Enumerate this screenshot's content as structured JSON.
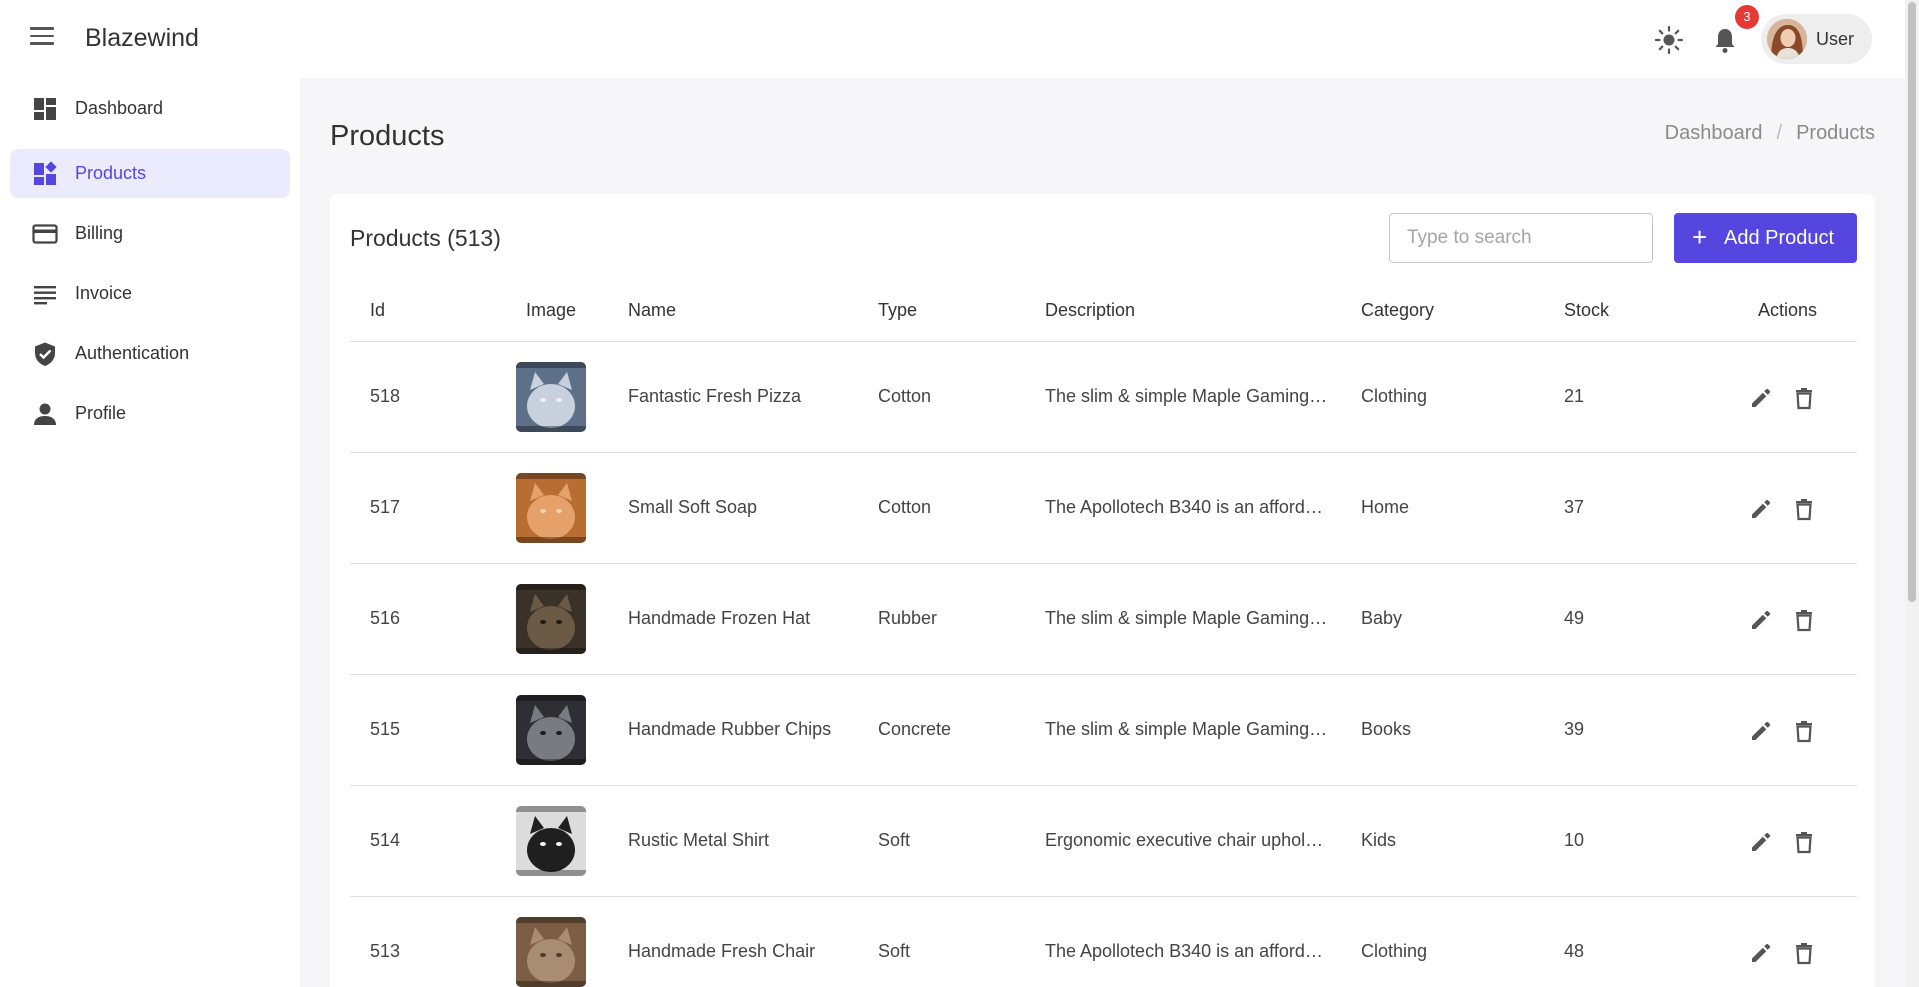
{
  "app": {
    "brand": "Blazewind",
    "notifications_count": "3",
    "user_label": "User"
  },
  "sidebar": {
    "items": [
      {
        "label": "Dashboard",
        "icon": "dashboard-icon"
      },
      {
        "label": "Products",
        "icon": "products-icon",
        "active": true
      },
      {
        "label": "Billing",
        "icon": "credit-card-icon"
      },
      {
        "label": "Invoice",
        "icon": "lines-icon"
      },
      {
        "label": "Authentication",
        "icon": "shield-icon"
      },
      {
        "label": "Profile",
        "icon": "person-icon"
      }
    ]
  },
  "page": {
    "title": "Products",
    "breadcrumb": [
      "Dashboard",
      "Products"
    ]
  },
  "card": {
    "title": "Products (513)",
    "search_placeholder": "Type to search",
    "add_button": "Add Product"
  },
  "table": {
    "headers": [
      "Id",
      "Image",
      "Name",
      "Type",
      "Description",
      "Category",
      "Stock",
      "Actions"
    ],
    "rows": [
      {
        "id": "518",
        "name": "Fantastic Fresh Pizza",
        "type": "Cotton",
        "description": "The slim & simple Maple Gaming…",
        "category": "Clothing",
        "stock": "21"
      },
      {
        "id": "517",
        "name": "Small Soft Soap",
        "type": "Cotton",
        "description": "The Apollotech B340 is an afford…",
        "category": "Home",
        "stock": "37"
      },
      {
        "id": "516",
        "name": "Handmade Frozen Hat",
        "type": "Rubber",
        "description": "The slim & simple Maple Gaming…",
        "category": "Baby",
        "stock": "49"
      },
      {
        "id": "515",
        "name": "Handmade Rubber Chips",
        "type": "Concrete",
        "description": "The slim & simple Maple Gaming…",
        "category": "Books",
        "stock": "39"
      },
      {
        "id": "514",
        "name": "Rustic Metal Shirt",
        "type": "Soft",
        "description": "Ergonomic executive chair uphol…",
        "category": "Kids",
        "stock": "10"
      },
      {
        "id": "513",
        "name": "Handmade Fresh Chair",
        "type": "Soft",
        "description": "The Apollotech B340 is an afford…",
        "category": "Clothing",
        "stock": "48"
      }
    ]
  },
  "colors": {
    "accent": "#5546e0",
    "accent_light": "#ecebfd",
    "badge": "#e53935",
    "main_bg": "#f6f6f8"
  }
}
